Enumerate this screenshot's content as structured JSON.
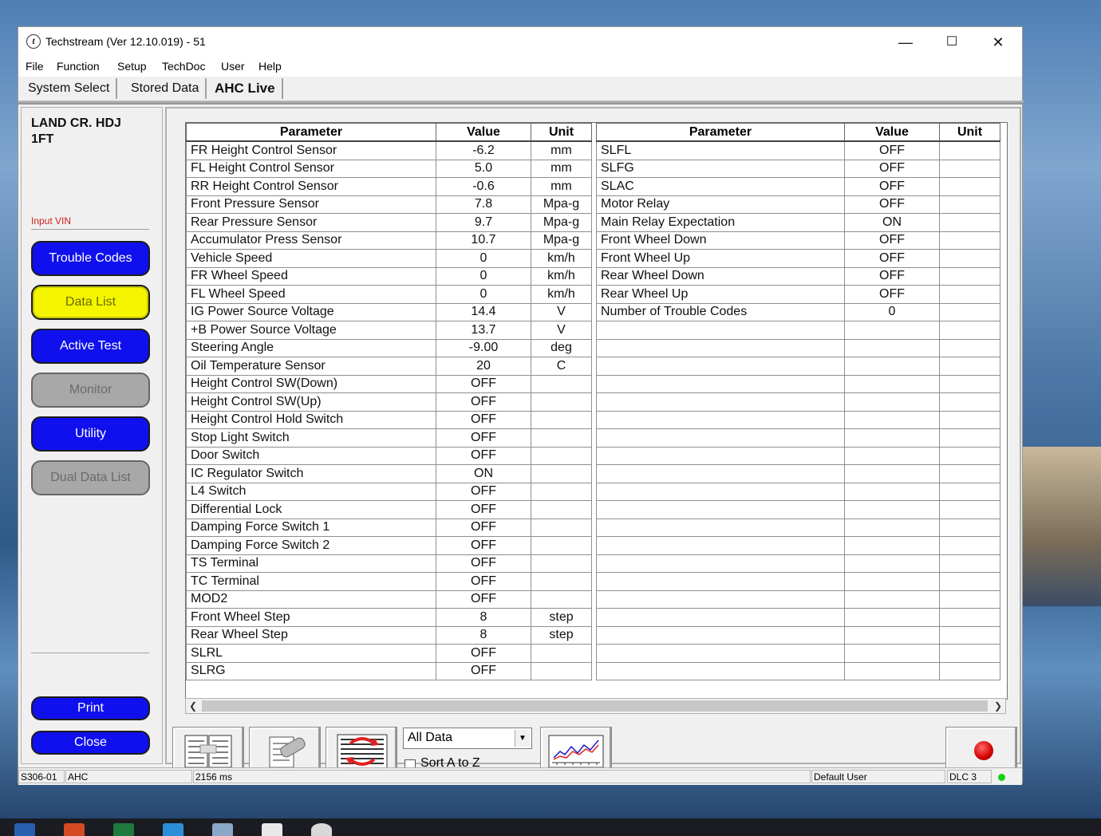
{
  "window": {
    "title": "Techstream (Ver 12.10.019) - 51",
    "minimize": "—",
    "maximize": "☐",
    "close": "✕"
  },
  "menu": [
    "File",
    "Function",
    "Setup",
    "TechDoc",
    "User",
    "Help"
  ],
  "tabs": [
    "System Select",
    "Stored Data",
    "AHC Live"
  ],
  "sidebar": {
    "model": "LAND CR. HDJ\n1FT",
    "input_vin": "Input VIN",
    "buttons": [
      "Trouble Codes",
      "Data List",
      "Active Test",
      "Monitor",
      "Utility",
      "Dual Data List"
    ],
    "print": "Print",
    "close": "Close"
  },
  "table": {
    "headers": [
      "Parameter",
      "Value",
      "Unit"
    ],
    "left_rows": [
      [
        "FR Height Control Sensor",
        "-6.2",
        "mm"
      ],
      [
        "FL Height Control Sensor",
        "5.0",
        "mm"
      ],
      [
        "RR Height Control Sensor",
        "-0.6",
        "mm"
      ],
      [
        "Front Pressure Sensor",
        "7.8",
        "Mpa-g"
      ],
      [
        "Rear Pressure Sensor",
        "9.7",
        "Mpa-g"
      ],
      [
        "Accumulator Press Sensor",
        "10.7",
        "Mpa-g"
      ],
      [
        "Vehicle Speed",
        "0",
        "km/h"
      ],
      [
        "FR Wheel Speed",
        "0",
        "km/h"
      ],
      [
        "FL Wheel Speed",
        "0",
        "km/h"
      ],
      [
        "IG Power Source Voltage",
        "14.4",
        "V"
      ],
      [
        "+B Power Source Voltage",
        "13.7",
        "V"
      ],
      [
        "Steering Angle",
        "-9.00",
        "deg"
      ],
      [
        "Oil Temperature Sensor",
        "20",
        "C"
      ],
      [
        "Height Control SW(Down)",
        "OFF",
        ""
      ],
      [
        "Height Control SW(Up)",
        "OFF",
        ""
      ],
      [
        "Height Control Hold Switch",
        "OFF",
        ""
      ],
      [
        "Stop Light Switch",
        "OFF",
        ""
      ],
      [
        "Door Switch",
        "OFF",
        ""
      ],
      [
        "IC Regulator Switch",
        "ON",
        ""
      ],
      [
        "L4 Switch",
        "OFF",
        ""
      ],
      [
        "Differential Lock",
        "OFF",
        ""
      ],
      [
        "Damping Force Switch 1",
        "OFF",
        ""
      ],
      [
        "Damping Force Switch 2",
        "OFF",
        ""
      ],
      [
        "TS Terminal",
        "OFF",
        ""
      ],
      [
        "TC Terminal",
        "OFF",
        ""
      ],
      [
        "MOD2",
        "OFF",
        ""
      ],
      [
        "Front Wheel Step",
        "8",
        "step"
      ],
      [
        "Rear Wheel Step",
        "8",
        "step"
      ],
      [
        "SLRL",
        "OFF",
        ""
      ],
      [
        "SLRG",
        "OFF",
        ""
      ]
    ],
    "right_rows": [
      [
        "SLFL",
        "OFF",
        ""
      ],
      [
        "SLFG",
        "OFF",
        ""
      ],
      [
        "SLAC",
        "OFF",
        ""
      ],
      [
        "Motor Relay",
        "OFF",
        ""
      ],
      [
        "Main Relay Expectation",
        "ON",
        ""
      ],
      [
        "Front Wheel Down",
        "OFF",
        ""
      ],
      [
        "Front Wheel Up",
        "OFF",
        ""
      ],
      [
        "Rear Wheel Down",
        "OFF",
        ""
      ],
      [
        "Rear Wheel Up",
        "OFF",
        ""
      ],
      [
        "Number of Trouble Codes",
        "0",
        ""
      ],
      [
        "",
        "",
        ""
      ],
      [
        "",
        "",
        ""
      ],
      [
        "",
        "",
        ""
      ],
      [
        "",
        "",
        ""
      ],
      [
        "",
        "",
        ""
      ],
      [
        "",
        "",
        ""
      ],
      [
        "",
        "",
        ""
      ],
      [
        "",
        "",
        ""
      ],
      [
        "",
        "",
        ""
      ],
      [
        "",
        "",
        ""
      ],
      [
        "",
        "",
        ""
      ],
      [
        "",
        "",
        ""
      ],
      [
        "",
        "",
        ""
      ],
      [
        "",
        "",
        ""
      ],
      [
        "",
        "",
        ""
      ],
      [
        "",
        "",
        ""
      ],
      [
        "",
        "",
        ""
      ],
      [
        "",
        "",
        ""
      ],
      [
        "",
        "",
        ""
      ],
      [
        "",
        "",
        ""
      ]
    ]
  },
  "toolbar": {
    "filter_value": "All Data",
    "sort_label": "Sort A to Z"
  },
  "statusbar": {
    "code": "S306-01",
    "system": "AHC",
    "timing": "2156 ms",
    "user": "Default User",
    "connection": "DLC 3"
  },
  "colors": {
    "button_blue": "#1010ee",
    "button_selected": "#f5f500",
    "button_disabled": "#a8a8a8",
    "record": "#d10000",
    "status_ok": "#16d116"
  }
}
